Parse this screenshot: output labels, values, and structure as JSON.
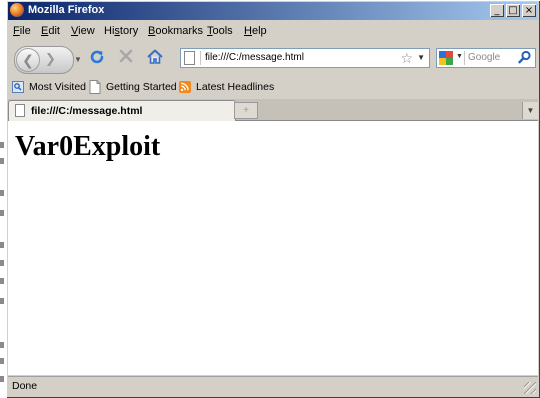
{
  "window": {
    "title": "Mozilla Firefox",
    "minimize_label": "_",
    "maximize_label": "□",
    "close_label": "×"
  },
  "menubar": {
    "items": [
      {
        "accel": "F",
        "rest": "ile"
      },
      {
        "accel": "E",
        "rest": "dit"
      },
      {
        "accel": "V",
        "rest": "iew"
      },
      {
        "pre": "Hi",
        "accel": "s",
        "rest": "tory"
      },
      {
        "accel": "B",
        "rest": "ookmarks"
      },
      {
        "accel": "T",
        "rest": "ools"
      },
      {
        "accel": "H",
        "rest": "elp"
      }
    ]
  },
  "navbar": {
    "icons": [
      "back-icon",
      "forward-icon",
      "reload-icon",
      "stop-icon",
      "home-icon"
    ],
    "url_value": "file:///C:/message.html",
    "search_placeholder": "Google",
    "search_engine_icon": "google-icon"
  },
  "bookmarks": {
    "items": [
      {
        "label": "Most Visited",
        "icon": "most-visited-icon"
      },
      {
        "label": "Getting Started",
        "icon": "page-icon"
      },
      {
        "label": "Latest Headlines",
        "icon": "rss-feed-icon"
      }
    ]
  },
  "tabs": {
    "active": {
      "label": "file:///C:/message.html"
    },
    "new_tab_label": "+"
  },
  "content": {
    "heading": "Var0Exploit"
  },
  "status": {
    "text": "Done"
  },
  "colors": {
    "titlebar_start": "#0a246a",
    "titlebar_end": "#a6caf0",
    "chrome": "#d4d0c8",
    "reload": "#2a7ad6",
    "home": "#3a6ec0"
  }
}
